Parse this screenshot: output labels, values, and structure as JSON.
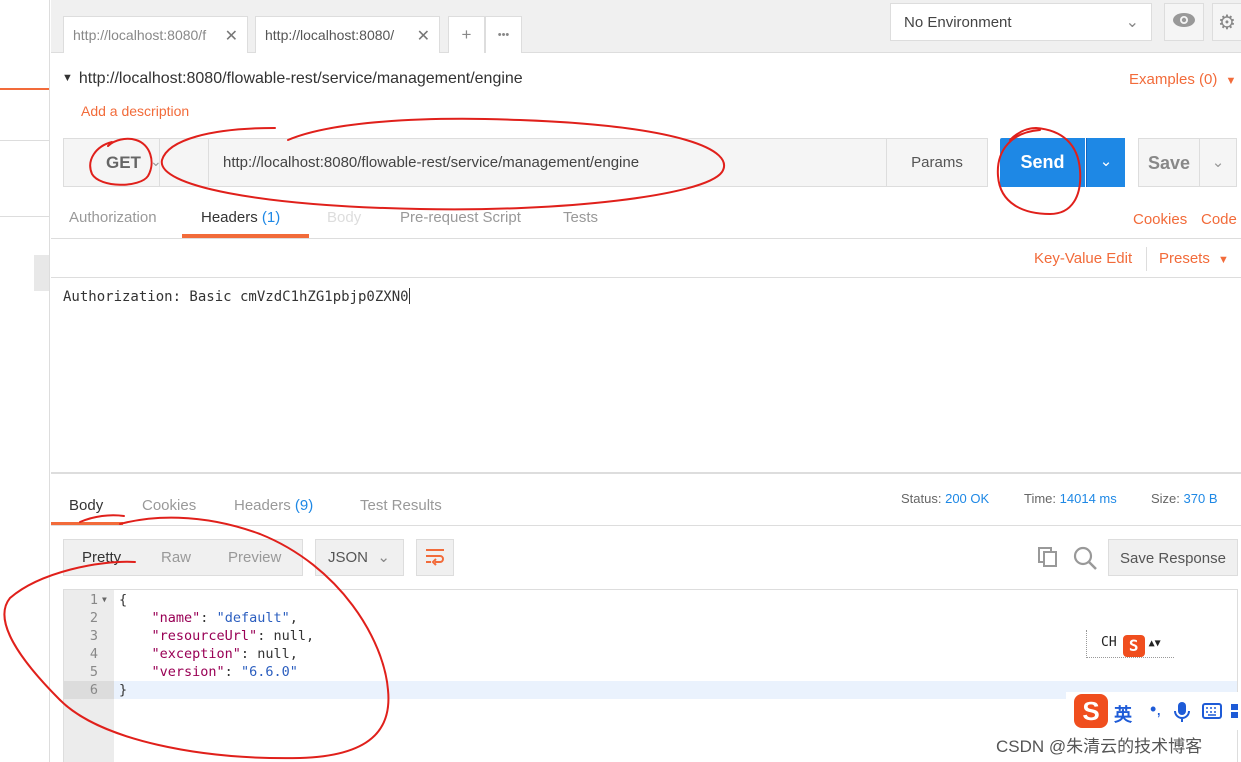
{
  "tabs": [
    {
      "label": "http://localhost:8080/f"
    },
    {
      "label": "http://localhost:8080/"
    }
  ],
  "tab_close": "✕",
  "tab_add": "+",
  "tab_more": "•••",
  "environment": {
    "label": "No Environment"
  },
  "request": {
    "title": "http://localhost:8080/flowable-rest/service/management/engine",
    "add_description": "Add a description",
    "examples": "Examples (0)",
    "method": "GET",
    "url": "http://localhost:8080/flowable-rest/service/management/engine",
    "params": "Params",
    "send": "Send",
    "save": "Save"
  },
  "request_tabs": {
    "authorization": "Authorization",
    "headers": "Headers",
    "headers_count": "(1)",
    "body": "Body",
    "prerequest": "Pre-request Script",
    "tests": "Tests",
    "cookies": "Cookies",
    "code": "Code"
  },
  "headers_editor": {
    "key_value_edit": "Key-Value Edit",
    "presets": "Presets",
    "text": "Authorization: Basic cmVzdC1hZG1pbjp0ZXN0"
  },
  "response": {
    "tabs": {
      "body": "Body",
      "cookies": "Cookies",
      "headers": "Headers",
      "headers_count": "(9)",
      "test_results": "Test Results"
    },
    "status_label": "Status:",
    "status_value": "200 OK",
    "time_label": "Time:",
    "time_value": "14014 ms",
    "size_label": "Size:",
    "size_value": "370 B",
    "view_modes": [
      "Pretty",
      "Raw",
      "Preview"
    ],
    "format": "JSON",
    "save_response": "Save Response",
    "code_lines": [
      {
        "n": "1",
        "text": "{"
      },
      {
        "n": "2",
        "key": "\"name\"",
        "value": "\"default\"",
        "kind": "str"
      },
      {
        "n": "3",
        "key": "\"resourceUrl\"",
        "value": "null",
        "kind": "lit"
      },
      {
        "n": "4",
        "key": "\"exception\"",
        "value": "null",
        "kind": "lit"
      },
      {
        "n": "5",
        "key": "\"version\"",
        "value": "\"6.6.0\"",
        "kind": "str"
      },
      {
        "n": "6",
        "text": "}"
      }
    ]
  },
  "ime_small": {
    "text": "CH",
    "logo": "S"
  },
  "ime_bar": {
    "logo": "S",
    "lang": "英",
    "punct": "•,"
  },
  "watermark": "CSDN @朱清云的技术博客"
}
